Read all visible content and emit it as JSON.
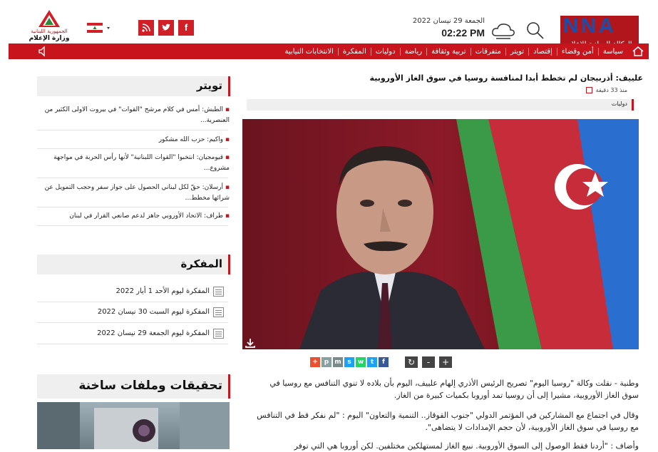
{
  "header": {
    "nna_logo_text": "NNA",
    "nna_logo_sub": "الوكالة الوطنية للإعلام",
    "date": "الجمعة 29 نيسان 2022",
    "time": "02:22 PM",
    "ministry_line1": "الجمهورية اللبنانية",
    "ministry_line2": "وزارة الإعلام",
    "social": [
      "f",
      "t",
      "rss"
    ]
  },
  "nav": {
    "items": [
      "سياسة",
      "أمن وقضاء",
      "إقتصاد",
      "تويتر",
      "متفرقات",
      "تربية وثقافة",
      "رياضة",
      "دوليات",
      "المفكرة",
      "الانتخابات النيابية"
    ]
  },
  "article": {
    "title": "علييف: أذربيجان لم تخطط أبدا لمنافسة روسيا في سوق الغاز الأوروبية",
    "time": "منذ 33 دقيقة",
    "category": "دوليات",
    "paragraphs": [
      "وطنية -  نقلت وكالة \"روسيا اليوم\" تصريح الرئيس الأذري إلهام علييف، اليوم  بأن بلاده لا تنوي التنافس مع روسيا في سوق الغاز الأوروبية، مشيرا إلى أن روسيا تمد أوروبا بكميات كبيرة من الغاز.",
      "وقال في اجتماع مع المشاركين في المؤتمر الدولي \"جنوب القوقاز.. التنمية والتعاون\" اليوم : \"لم نفكر قط في التنافس مع روسيا في سوق الغاز الأوروبية، لأن حجم الإمدادات لا يتضاهى\".",
      "وأضاف : \"أردنا فقط الوصول إلى السوق الأوروبية. نبيع الغاز لمستهلكين مختلفين. لكن أوروبا هي التي توفر"
    ],
    "share": [
      "f",
      "t",
      "w",
      "s",
      "m",
      "p",
      "+"
    ],
    "font_controls": [
      "+",
      "-",
      "↻"
    ]
  },
  "sidebar": {
    "twitter_title": "تويتر",
    "tweets": [
      {
        "b": "الطبش:",
        "t": " أمس في كلام مرشح \"القوات\" في بيروت الاولى الكثير من العنصرية..."
      },
      {
        "b": "واكيم:",
        "t": " حزب الله مشكور"
      },
      {
        "b": "قيومجيان:",
        "t": " انتخبوا \"القوات اللبنانية\" لأنها رأس الحربة في مواجهة مشروع..."
      },
      {
        "b": "أرسلان:",
        "t": " حقّ لكل لبناني الحصول على جواز سفر وحجب التمويل عن شرائها مخطط..."
      },
      {
        "b": "طراف:",
        "t": " الاتحاد الأوروبي جاهز لدعم صانعي القرار في لبنان"
      }
    ],
    "memo_title": "المفكرة",
    "memos": [
      "المفكرة ليوم الأحد 1 أيار 2022",
      "المفكرة ليوم السبت 30 نيسان 2022",
      "المفكرة ليوم الجمعة 29 نيسان 2022"
    ],
    "invest_title": "تحقيقات وملفات ساخنة"
  },
  "colors": {
    "brand_red": "#c8141c",
    "nav_red": "#c8141c"
  }
}
